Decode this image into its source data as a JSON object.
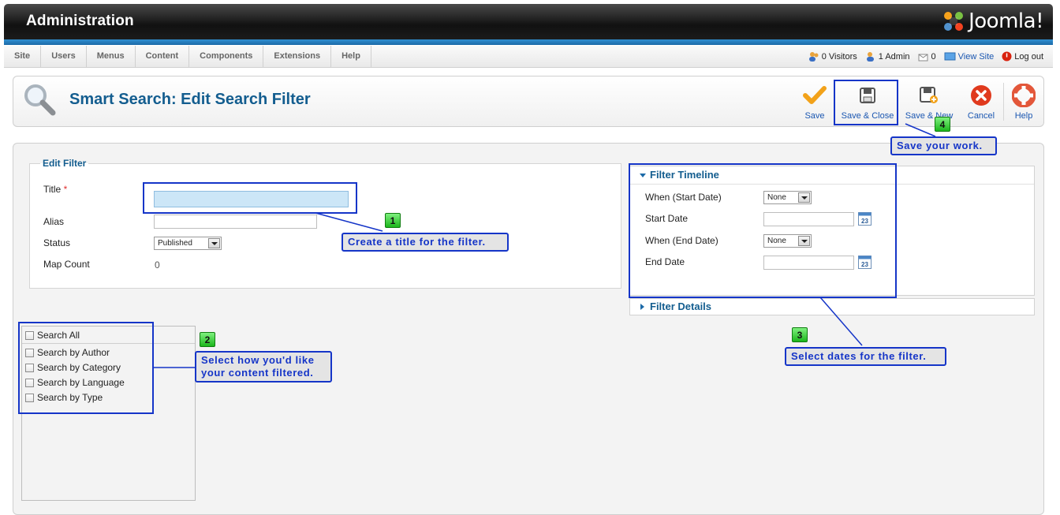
{
  "header": {
    "title": "Administration",
    "logo_text": "Joomla!"
  },
  "menu": {
    "items": [
      "Site",
      "Users",
      "Menus",
      "Content",
      "Components",
      "Extensions",
      "Help"
    ]
  },
  "status": {
    "visitors": "0 Visitors",
    "admins": "1 Admin",
    "messages": "0",
    "view_site": "View Site",
    "logout": "Log out"
  },
  "toolbar": {
    "page_title": "Smart Search: Edit Search Filter",
    "save": "Save",
    "save_close": "Save & Close",
    "save_new": "Save & New",
    "cancel": "Cancel",
    "help": "Help"
  },
  "edit_filter": {
    "legend": "Edit Filter",
    "title_label": "Title",
    "required_mark": "*",
    "title_value": "",
    "alias_label": "Alias",
    "alias_value": "",
    "status_label": "Status",
    "status_value": "Published",
    "map_count_label": "Map Count",
    "map_count_value": "0"
  },
  "timeline": {
    "heading": "Filter Timeline",
    "when_start_label": "When (Start Date)",
    "when_start_value": "None",
    "start_date_label": "Start Date",
    "start_date_value": "",
    "when_end_label": "When (End Date)",
    "when_end_value": "None",
    "end_date_label": "End Date",
    "end_date_value": "",
    "calendar_day": "23"
  },
  "details": {
    "heading": "Filter Details"
  },
  "filters": {
    "search_all": "Search All",
    "options": [
      "Search by Author",
      "Search by Category",
      "Search by Language",
      "Search by Type"
    ]
  },
  "callouts": {
    "c1": {
      "number": "1",
      "text": "Create a title for the filter."
    },
    "c2": {
      "number": "2",
      "text": "Select how you'd like your content filtered."
    },
    "c3": {
      "number": "3",
      "text": "Select dates for the filter."
    },
    "c4": {
      "number": "4",
      "text": "Save your work."
    }
  },
  "colors": {
    "accent": "#135d8f",
    "callout_border": "#1535c8",
    "badge_green": "#1cb61c",
    "cancel_red": "#e03a1e",
    "save_orange": "#f2a21a"
  }
}
